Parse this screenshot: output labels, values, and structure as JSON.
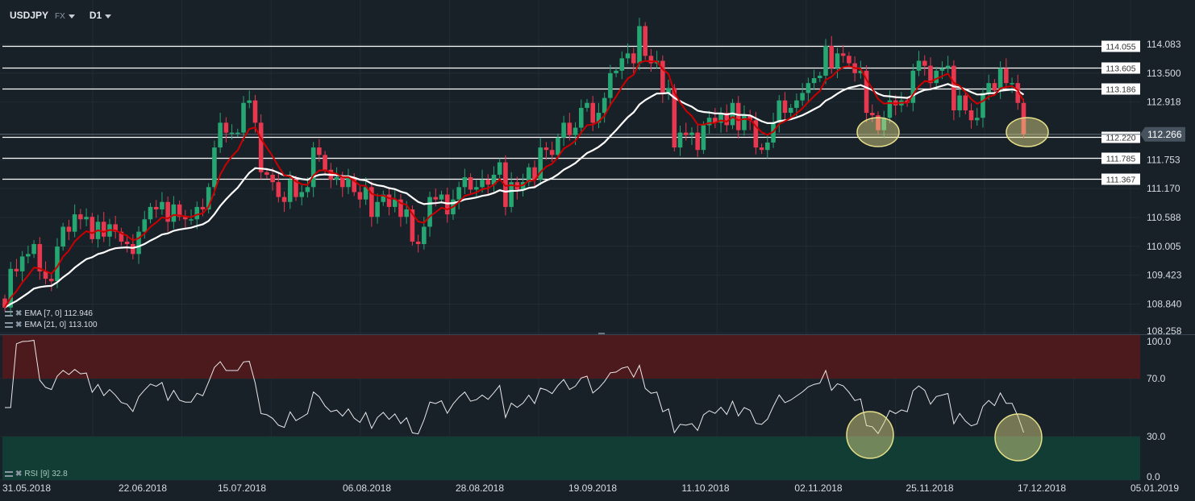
{
  "header": {
    "symbol": "USDJPY",
    "market": "FX",
    "timeframe": "D1"
  },
  "indicators": {
    "ema7": {
      "label": "EMA [7, 0]",
      "value": "112.946",
      "color": "#cc0000"
    },
    "ema21": {
      "label": "EMA [21, 0]",
      "value": "113.100",
      "color": "#ffffff"
    },
    "rsi": {
      "label": "RSI",
      "param": "[9]",
      "value": "32.8"
    }
  },
  "colors": {
    "background": "#182028",
    "bull": "#26a672",
    "bear": "#e8384f",
    "overbought_zone": "#4c191d",
    "oversold_zone": "#113d34",
    "highlight": "#e6e08a"
  },
  "chart_data": [
    {
      "type": "candlestick",
      "title": "USDJPY",
      "price_axis_ticks": [
        "114.083",
        "113.500",
        "112.918",
        "112.266",
        "111.753",
        "111.170",
        "110.588",
        "110.005",
        "109.423",
        "108.840",
        "108.258"
      ],
      "ylim": [
        108.258,
        114.083
      ],
      "current_price": "112.266",
      "x_tick_labels": [
        "31.05.2018",
        "22.06.2018",
        "15.07.2018",
        "06.08.2018",
        "28.08.2018",
        "19.09.2018",
        "11.10.2018",
        "02.11.2018",
        "25.11.2018",
        "17.12.2018",
        "05.01.2019"
      ],
      "first_open": 108.95,
      "close": [
        108.77,
        109.55,
        109.5,
        109.8,
        109.85,
        110.05,
        109.5,
        109.35,
        109.3,
        110.0,
        110.4,
        110.3,
        110.65,
        110.55,
        110.6,
        110.15,
        110.5,
        110.2,
        110.45,
        110.3,
        110.1,
        110.05,
        109.85,
        110.3,
        110.55,
        110.8,
        110.75,
        110.9,
        110.5,
        110.85,
        110.6,
        110.55,
        110.55,
        110.8,
        110.75,
        111.2,
        112.0,
        112.5,
        112.3,
        112.3,
        112.3,
        112.9,
        112.95,
        112.5,
        111.5,
        111.45,
        111.3,
        111.0,
        110.9,
        111.35,
        111.0,
        111.1,
        111.2,
        112.0,
        111.85,
        111.55,
        111.35,
        111.4,
        111.2,
        111.4,
        111.1,
        110.95,
        111.2,
        110.6,
        110.9,
        111.05,
        110.8,
        110.95,
        110.6,
        110.75,
        110.1,
        110.05,
        110.4,
        111.0,
        110.95,
        111.05,
        110.65,
        110.95,
        111.2,
        111.4,
        111.15,
        111.2,
        111.35,
        111.25,
        111.45,
        111.7,
        110.8,
        111.3,
        111.15,
        111.3,
        111.6,
        111.35,
        112.0,
        111.95,
        111.85,
        112.2,
        112.5,
        112.25,
        112.4,
        112.8,
        112.9,
        112.5,
        112.7,
        113.0,
        113.5,
        113.55,
        113.8,
        113.9,
        113.7,
        114.45,
        113.85,
        113.7,
        113.75,
        113.1,
        113.2,
        112.0,
        112.3,
        112.25,
        112.3,
        111.95,
        112.45,
        112.6,
        112.5,
        112.7,
        112.45,
        112.9,
        112.35,
        112.65,
        112.55,
        112.0,
        111.95,
        112.1,
        112.5,
        112.95,
        112.7,
        112.8,
        112.95,
        113.1,
        113.3,
        113.4,
        113.45,
        114.05,
        113.6,
        113.9,
        113.85,
        113.7,
        113.5,
        113.55,
        112.7,
        112.65,
        112.35,
        112.6,
        112.95,
        112.85,
        112.95,
        112.9,
        113.55,
        113.75,
        113.65,
        113.3,
        113.55,
        113.6,
        113.65,
        112.75,
        113.05,
        112.75,
        112.55,
        112.6,
        113.1,
        113.3,
        113.15,
        113.6,
        113.3,
        113.3,
        112.9,
        112.27
      ],
      "levels": [
        {
          "label": "114.055",
          "value": 114.055
        },
        {
          "label": "113.605",
          "value": 113.605
        },
        {
          "label": "113.186",
          "value": 113.186
        },
        {
          "label": "112.220",
          "value": 112.22
        },
        {
          "label": "111.785",
          "value": 111.785
        },
        {
          "label": "111.367",
          "value": 111.367
        }
      ],
      "overlays": [
        "EMA 7",
        "EMA 21"
      ]
    },
    {
      "type": "line",
      "title": "RSI [9]",
      "ylim": [
        0,
        100
      ],
      "y_tick_labels": [
        "100.0",
        "70.0",
        "30.0",
        "0.0"
      ],
      "zones": [
        {
          "from": 70,
          "to": 100,
          "name": "overbought"
        },
        {
          "from": 0,
          "to": 30,
          "name": "oversold"
        }
      ],
      "last_value": 32.8
    }
  ]
}
